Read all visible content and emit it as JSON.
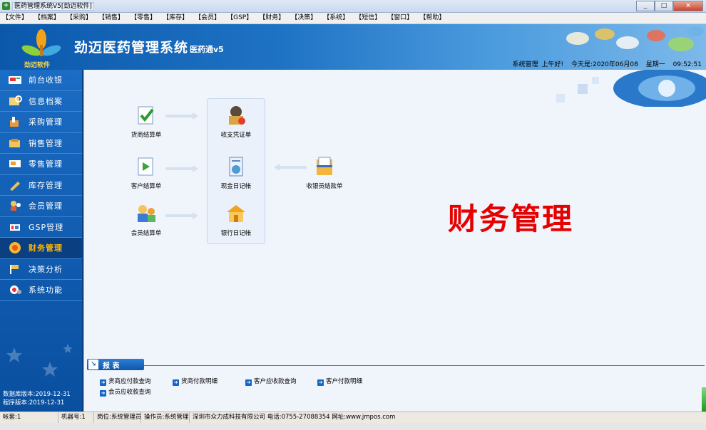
{
  "window": {
    "title": "医药管理系统V5[劲迈软件]",
    "controls": {
      "minimize": "_",
      "maximize": "□",
      "close": "×"
    }
  },
  "menu": {
    "items": [
      "【文件】",
      "【档案】",
      "【采购】",
      "【销售】",
      "【零售】",
      "【库存】",
      "【会员】",
      "【GSP】",
      "【财务】",
      "【决策】",
      "【系统】",
      "【短信】",
      "【窗口】",
      "【帮助】"
    ]
  },
  "header": {
    "logo_caption": "劲迈软件",
    "brand": "劲迈医药管理系统",
    "brand_sub": "医药通v5",
    "status": {
      "user": "系统管理",
      "greeting": "上午好!",
      "date": "今天是:2020年06月08",
      "weekday": "星期一",
      "time": "09:52:51"
    }
  },
  "sidebar": {
    "items": [
      {
        "label": "前台收银",
        "icon": "cash-register-icon"
      },
      {
        "label": "信息档案",
        "icon": "archive-icon"
      },
      {
        "label": "采购管理",
        "icon": "purchase-icon"
      },
      {
        "label": "销售管理",
        "icon": "sales-icon"
      },
      {
        "label": "零售管理",
        "icon": "retail-icon"
      },
      {
        "label": "库存管理",
        "icon": "inventory-icon"
      },
      {
        "label": "会员管理",
        "icon": "member-icon"
      },
      {
        "label": "GSP管理",
        "icon": "gsp-icon"
      },
      {
        "label": "财务管理",
        "icon": "finance-icon",
        "active": true
      },
      {
        "label": "决策分析",
        "icon": "decision-icon"
      },
      {
        "label": "系统功能",
        "icon": "system-icon"
      }
    ],
    "db_version": "数据库版本:2019-12-31",
    "app_version": "程序版本:2019-12-31"
  },
  "flow": {
    "supplier_settlement": "货商结算单",
    "voucher": "收支凭证单",
    "customer_settlement": "客户结算单",
    "cash_journal": "现金日记帐",
    "cashier_settlement": "收银员结款单",
    "member_settlement": "会员结算单",
    "bank_journal": "银行日记帐"
  },
  "page_title": "财务管理",
  "reports": {
    "tab_label": "报 表",
    "links": [
      "货商应付款查询",
      "货商付款明细",
      "客户应收款查询",
      "客户付款明细",
      "会员应收款查询"
    ]
  },
  "statusbar": {
    "account": "帐套:1",
    "machine": "机器号:1",
    "post": "岗位:系统管理员",
    "operator": "操作员:系统管理",
    "company": "深圳市众力成科技有限公司 电话:0755-27088354 网址:www.jmpos.com"
  },
  "colors": {
    "sidebar": "#0f5aae",
    "active_label": "#ffb400",
    "title_red": "#e60000",
    "header_start": "#0b58ab"
  }
}
